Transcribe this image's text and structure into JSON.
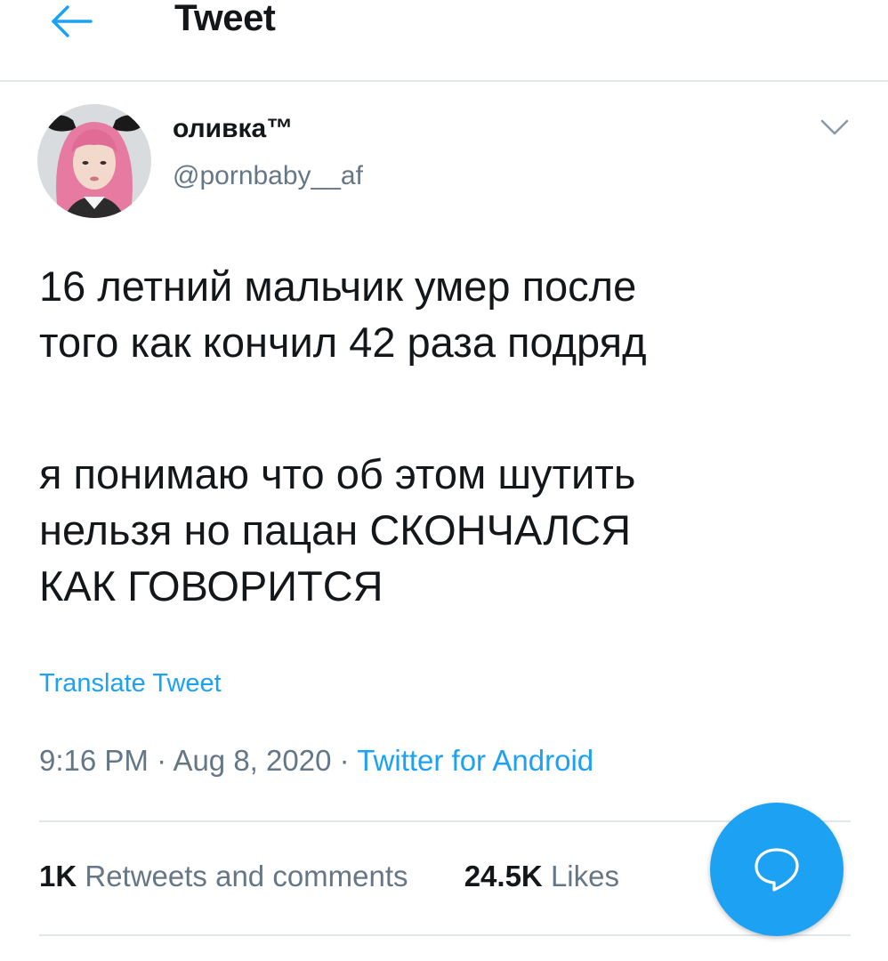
{
  "header": {
    "back_icon": "back-arrow-icon",
    "title": "Tweet"
  },
  "tweet": {
    "author": {
      "display_name": "оливка™",
      "handle": "@pornbaby__af",
      "avatar_icon": "avatar-photo"
    },
    "menu_icon": "chevron-down-icon",
    "text_lines_1": [
      "16 летний мальчик умер после",
      "того как кончил 42 раза подряд"
    ],
    "text_lines_2": [
      "я понимаю что об этом шутить",
      "нельзя но пацан СКОНЧАЛСЯ",
      "КАК ГОВОРИТСЯ"
    ],
    "translate_label": "Translate Tweet",
    "time": "9:16 PM",
    "separator": "·",
    "date": "Aug 8, 2020",
    "source": "Twitter for Android"
  },
  "stats": {
    "retweets_count": "1K",
    "retweets_label": "Retweets and comments",
    "likes_count": "24.5K",
    "likes_label": "Likes"
  },
  "fab": {
    "icon": "compose-reply-icon"
  },
  "colors": {
    "accent": "#1da1f2",
    "text_primary": "#14171a",
    "text_secondary": "#657786",
    "divider": "#e1e8ed"
  }
}
